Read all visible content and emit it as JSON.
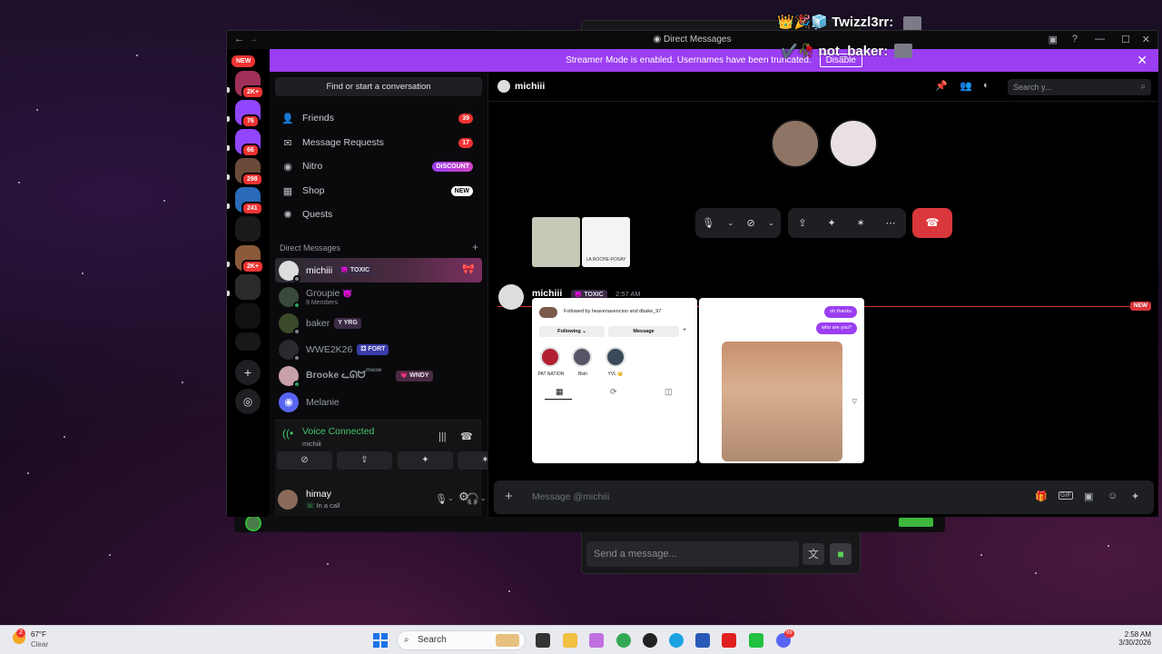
{
  "overlay": {
    "chat": [
      {
        "name": "Twizzl3rr:",
        "prefix": "👑🎉🧊"
      },
      {
        "name": "not_baker:",
        "prefix": "✔️🥀"
      }
    ],
    "send_placeholder": "Send a message..."
  },
  "window": {
    "title": "Direct Messages",
    "banner_text": "Streamer Mode is enabled. Usernames have been truncated.",
    "banner_button": "Disable"
  },
  "servers": {
    "new_label": "NEW",
    "badges": [
      "2K+",
      "76",
      "66",
      "298",
      "241",
      "2K+"
    ]
  },
  "dm_sidebar": {
    "find_label": "Find or start a conversation",
    "nav": [
      {
        "label": "Friends",
        "icon": "friends-icon",
        "badge": "39"
      },
      {
        "label": "Message Requests",
        "icon": "mail-icon",
        "badge": "17"
      },
      {
        "label": "Nitro",
        "icon": "nitro-icon",
        "badge": "DISCOUNT"
      },
      {
        "label": "Shop",
        "icon": "shop-icon",
        "badge": "NEW"
      },
      {
        "label": "Quests",
        "icon": "quests-icon",
        "badge": ""
      }
    ],
    "section_title": "Direct Messages",
    "dms": [
      {
        "name": "michiii",
        "tag": "TOXIC",
        "sub": ""
      },
      {
        "name": "Groupie",
        "tag": "",
        "sub": "9 Members"
      },
      {
        "name": "baker",
        "tag": "YRG",
        "sub": ""
      },
      {
        "name": "WWE2K26",
        "tag": "FORT",
        "sub": ""
      },
      {
        "name": "Brooke ᓚᘏᗢ",
        "tag": "WNDY",
        "sub": "meow"
      },
      {
        "name": "Melanie",
        "tag": "",
        "sub": ""
      }
    ]
  },
  "voice": {
    "status": "Voice Connected",
    "channel": "michiii"
  },
  "user": {
    "name": "himay",
    "status": "In a call"
  },
  "chat": {
    "header_name": "michiii",
    "search_placeholder": "Search y...",
    "new_label": "NEW",
    "message": {
      "author": "michiii",
      "tag": "TOXIC",
      "time": "2:57 AM"
    },
    "input_placeholder": "Message @michiii",
    "image_caption": "LA ROCHE-POSAY",
    "profile": {
      "followed_by": "Followed by heavenasencioo and dbake_97",
      "following_btn": "Following ⌄",
      "message_btn": "Message",
      "highlights": [
        "PAT NATION",
        "Blah",
        "YVL 👑"
      ]
    },
    "dm_bubbles": [
      "oh thanks",
      "who are you?"
    ]
  },
  "taskbar": {
    "weather_temp": "67°F",
    "weather_desc": "Clear",
    "weather_badge": "2",
    "search_label": "Search",
    "time": "2:58 AM",
    "date": "3/30/2026",
    "discord_badge": "99"
  },
  "colors": {
    "accent_purple": "#9b3ef2",
    "danger_red": "#da373c",
    "online_green": "#23a55a"
  }
}
